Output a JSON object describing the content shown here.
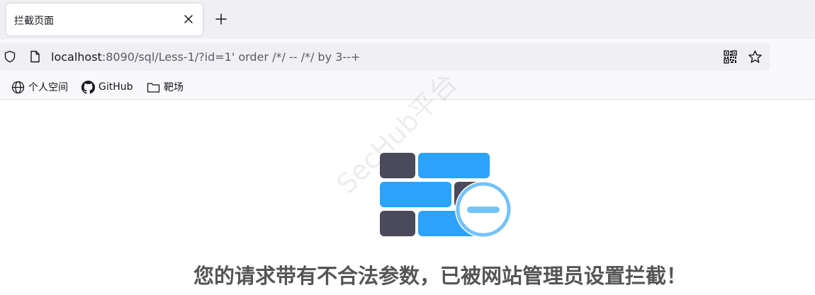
{
  "tab": {
    "title": "拦截页面",
    "close_icon": "close-icon"
  },
  "new_tab_icon": "plus-icon",
  "address_bar": {
    "host": "localhost",
    "rest": ":8090/sql/Less-1/?id=1' order /*/ -- /*/ by 3--+",
    "icons": [
      "shield-icon",
      "page-icon",
      "qr-code-icon",
      "star-icon"
    ]
  },
  "bookmarks": [
    {
      "label": "个人空间",
      "icon": "globe-icon"
    },
    {
      "label": "GitHub",
      "icon": "github-icon"
    },
    {
      "label": "靶场",
      "icon": "folder-icon"
    }
  ],
  "page": {
    "watermark": "SecHub平台",
    "message": "您的请求带有不合法参数，已被网站管理员设置拦截！",
    "illustration": "firewall-blocked-icon",
    "colors": {
      "blue": "#2ba3fd",
      "dark": "#4a4a5a",
      "light_blue": "#74c2fa"
    }
  }
}
